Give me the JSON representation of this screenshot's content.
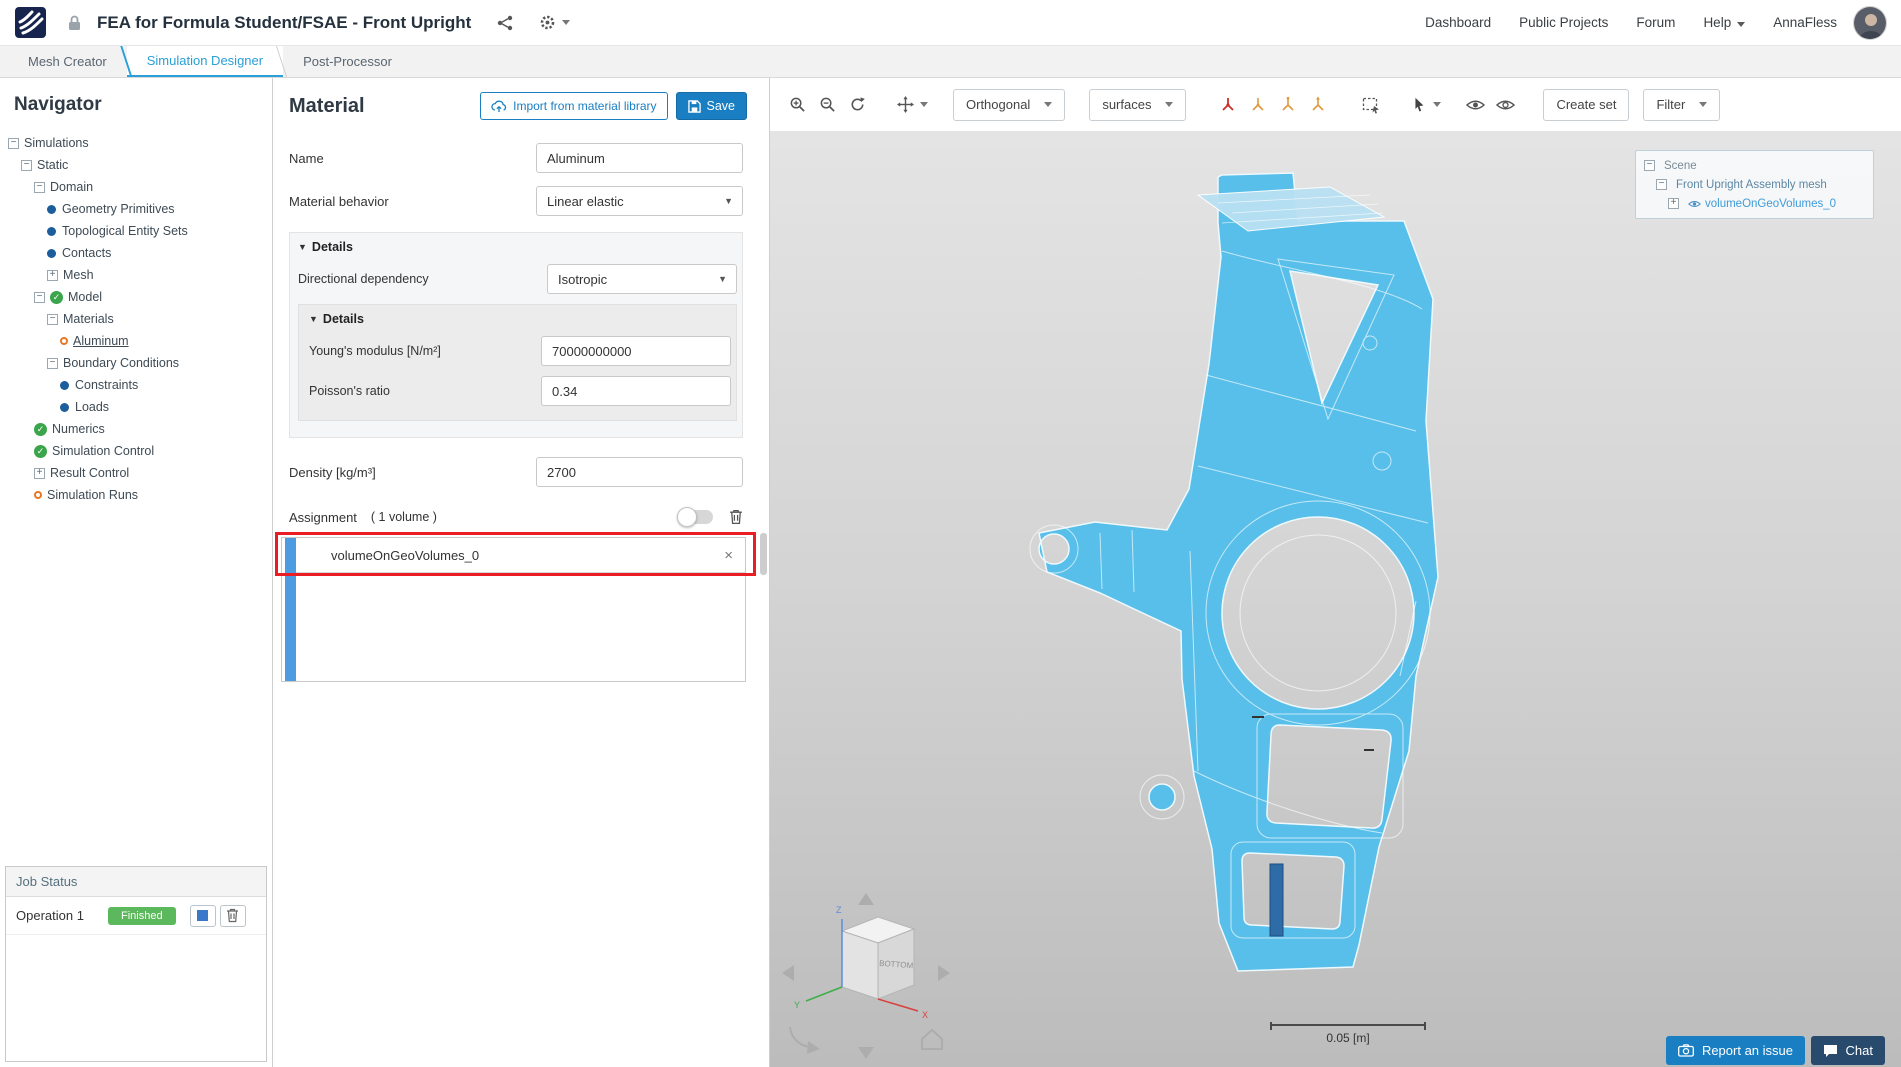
{
  "topbar": {
    "title": "FEA for Formula Student/FSAE - Front Upright",
    "nav_items": [
      {
        "label": "Dashboard"
      },
      {
        "label": "Public Projects"
      },
      {
        "label": "Forum"
      },
      {
        "label": "Help",
        "caret": true
      },
      {
        "label": "AnnaFless"
      }
    ]
  },
  "tabs": [
    {
      "label": "Mesh Creator",
      "active": false
    },
    {
      "label": "Simulation Designer",
      "active": true
    },
    {
      "label": "Post-Processor",
      "active": false
    }
  ],
  "navigator": {
    "title": "Navigator",
    "tree": [
      {
        "label": "Simulations",
        "level": 0,
        "box": "minus"
      },
      {
        "label": "Static",
        "level": 1,
        "box": "minus"
      },
      {
        "label": "Domain",
        "level": 2,
        "box": "minus"
      },
      {
        "label": "Geometry Primitives",
        "level": 3,
        "icon": "dot"
      },
      {
        "label": "Topological Entity Sets",
        "level": 3,
        "icon": "dot"
      },
      {
        "label": "Contacts",
        "level": 3,
        "icon": "dot"
      },
      {
        "label": "Mesh",
        "level": 3,
        "box": "plus"
      },
      {
        "label": "Model",
        "level": 2,
        "box": "minus",
        "icon": "check"
      },
      {
        "label": "Materials",
        "level": 3,
        "box": "minus"
      },
      {
        "label": "Aluminum",
        "level": 4,
        "icon": "orange",
        "selected": true
      },
      {
        "label": "Boundary Conditions",
        "level": 3,
        "box": "minus"
      },
      {
        "label": "Constraints",
        "level": 4,
        "icon": "dot"
      },
      {
        "label": "Loads",
        "level": 4,
        "icon": "dot"
      },
      {
        "label": "Numerics",
        "level": 2,
        "icon": "check"
      },
      {
        "label": "Simulation Control",
        "level": 2,
        "icon": "check"
      },
      {
        "label": "Result Control",
        "level": 2,
        "box": "plus"
      },
      {
        "label": "Simulation Runs",
        "level": 2,
        "icon": "orange"
      }
    ]
  },
  "job_status": {
    "title": "Job Status",
    "operation": "Operation 1",
    "status": "Finished"
  },
  "material": {
    "title": "Material",
    "import_label": "Import from material library",
    "save_label": "Save",
    "name_label": "Name",
    "name_value": "Aluminum",
    "behavior_label": "Material behavior",
    "behavior_value": "Linear elastic",
    "details_label": "Details",
    "directional_label": "Directional dependency",
    "directional_value": "Isotropic",
    "inner_details_label": "Details",
    "youngs_label": "Young's modulus [N/m²]",
    "youngs_value": "70000000000",
    "poisson_label": "Poisson's ratio",
    "poisson_value": "0.34",
    "density_label": "Density [kg/m³]",
    "density_value": "2700",
    "assignment_label": "Assignment",
    "assignment_count": "( 1 volume )",
    "assignment_items": [
      {
        "name": "volumeOnGeoVolumes_0"
      }
    ],
    "remove_glyph": "×"
  },
  "viewport": {
    "orthogonal_label": "Orthogonal",
    "surfaces_label": "surfaces",
    "create_set_label": "Create set",
    "filter_label": "Filter",
    "scene_tree": [
      {
        "label": "Scene",
        "level": 0,
        "box": "minus"
      },
      {
        "label": "Front Upright Assembly mesh",
        "level": 1,
        "box": "minus"
      },
      {
        "label": "volumeOnGeoVolumes_0",
        "level": 2,
        "box": "plus",
        "eye": true
      }
    ],
    "view_cube_label": "BOTTOM",
    "axis_labels": {
      "x": "X",
      "y": "Y",
      "z": "Z"
    },
    "scale_label": "0.05 [m]",
    "report_label": "Report an issue",
    "chat_label": "Chat"
  },
  "colors": {
    "accent_blue": "#1a7fc2",
    "model_blue": "#57bfe9",
    "highlight_red": "#ea1c24",
    "finished_green": "#5cb85c"
  }
}
